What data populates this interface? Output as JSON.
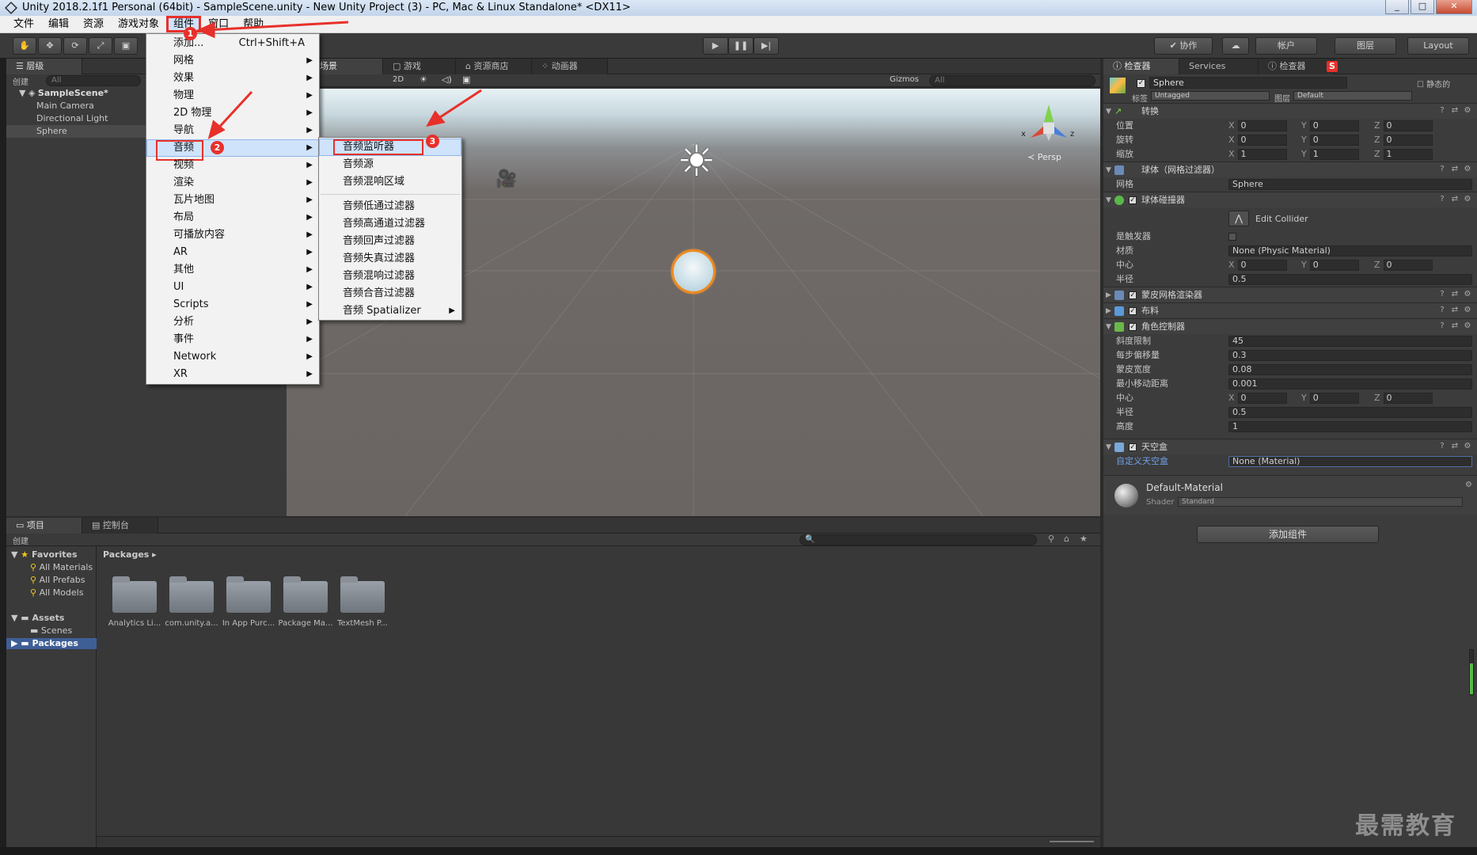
{
  "window": {
    "title": "Unity 2018.2.1f1 Personal (64bit) - SampleScene.unity - New Unity Project (3) - PC, Mac & Linux Standalone* <DX11>",
    "minimize": "_",
    "maximize": "□",
    "close": "✕"
  },
  "menubar": [
    "文件",
    "编辑",
    "资源",
    "游戏对象",
    "组件",
    "窗口",
    "帮助"
  ],
  "toolbar": {
    "collab": "✔ 协作",
    "account": "帐户",
    "layers": "图层",
    "layout": "Layout"
  },
  "hierarchy": {
    "tab": "层级",
    "create": "创建",
    "search_placeholder": "All",
    "scene": "SampleScene*",
    "items": [
      "Main Camera",
      "Directional Light",
      "Sphere"
    ]
  },
  "scene_view": {
    "tabs": [
      "场景",
      "游戏",
      "资源商店",
      "动画器"
    ],
    "mode_2d": "2D",
    "gizmos": "Gizmos",
    "search_placeholder": "All",
    "persp": "Persp",
    "axis_x": "x",
    "axis_z": "z"
  },
  "component_menu": {
    "items": [
      {
        "label": "添加...",
        "shortcut": "Ctrl+Shift+A",
        "sub": false
      },
      {
        "label": "网格",
        "sub": true
      },
      {
        "label": "效果",
        "sub": true
      },
      {
        "label": "物理",
        "sub": true
      },
      {
        "label": "2D 物理",
        "sub": true
      },
      {
        "label": "导航",
        "sub": true
      },
      {
        "label": "音频",
        "sub": true
      },
      {
        "label": "视频",
        "sub": true
      },
      {
        "label": "渲染",
        "sub": true
      },
      {
        "label": "瓦片地图",
        "sub": true
      },
      {
        "label": "布局",
        "sub": true
      },
      {
        "label": "可播放内容",
        "sub": true
      },
      {
        "label": "AR",
        "sub": true
      },
      {
        "label": "其他",
        "sub": true
      },
      {
        "label": "UI",
        "sub": true
      },
      {
        "label": "Scripts",
        "sub": true
      },
      {
        "label": "分析",
        "sub": true
      },
      {
        "label": "事件",
        "sub": true
      },
      {
        "label": "Network",
        "sub": true
      },
      {
        "label": "XR",
        "sub": true
      }
    ]
  },
  "audio_submenu": {
    "group1": [
      "音频监听器",
      "音频源",
      "音频混响区域"
    ],
    "group2": [
      "音频低通过滤器",
      "音频高通道过滤器",
      "音频回声过滤器",
      "音频失真过滤器",
      "音频混响过滤器",
      "音频合音过滤器",
      "音频 Spatializer"
    ]
  },
  "badges": [
    "1",
    "2",
    "3"
  ],
  "inspector": {
    "tabs": [
      "检查器",
      "Services",
      "检查器"
    ],
    "object_name": "Sphere",
    "static_label": "静态的",
    "tag_label": "标签",
    "tag_value": "Untagged",
    "layer_label": "图层",
    "layer_value": "Default",
    "transform": {
      "title": "转换",
      "rows": [
        {
          "label": "位置",
          "x": "0",
          "y": "0",
          "z": "0"
        },
        {
          "label": "旋转",
          "x": "0",
          "y": "0",
          "z": "0"
        },
        {
          "label": "缩放",
          "x": "1",
          "y": "1",
          "z": "1"
        }
      ]
    },
    "mesh_filter": {
      "title": "球体（网格过滤器）",
      "mesh_label": "网格",
      "mesh_value": "Sphere"
    },
    "sphere_collider": {
      "title": "球体碰撞器",
      "edit_button": "Edit Collider",
      "trigger_label": "是触发器",
      "material_label": "材质",
      "material_value": "None (Physic Material)",
      "center_label": "中心",
      "center": {
        "x": "0",
        "y": "0",
        "z": "0"
      },
      "radius_label": "半径",
      "radius_value": "0.5"
    },
    "skinned_mesh": {
      "title": "蒙皮网格渲染器"
    },
    "cloth": {
      "title": "布料"
    },
    "character_controller": {
      "title": "角色控制器",
      "rows": [
        {
          "label": "斜度限制",
          "value": "45"
        },
        {
          "label": "每步偏移量",
          "value": "0.3"
        },
        {
          "label": "蒙皮宽度",
          "value": "0.08"
        },
        {
          "label": "最小移动距离",
          "value": "0.001"
        }
      ],
      "center_label": "中心",
      "center": {
        "x": "0",
        "y": "0",
        "z": "0"
      },
      "radius_label": "半径",
      "radius_value": "0.5",
      "height_label": "高度",
      "height_value": "1"
    },
    "skybox": {
      "title": "天空盒",
      "custom_label": "自定义天空盒",
      "custom_value": "None (Material)"
    },
    "material": {
      "name": "Default-Material",
      "shader_label": "Shader",
      "shader_value": "Standard"
    },
    "add_component": "添加组件"
  },
  "project": {
    "tabs": [
      "项目",
      "控制台"
    ],
    "create": "创建",
    "favorites": "Favorites",
    "fav_items": [
      "All Materials",
      "All Prefabs",
      "All Models"
    ],
    "assets": "Assets",
    "scenes": "Scenes",
    "packages": "Packages",
    "breadcrumb": "Packages",
    "folders": [
      "Analytics Li...",
      "com.unity.a...",
      "In App Purc...",
      "Package Ma...",
      "TextMesh P..."
    ]
  },
  "watermark": "最需教育",
  "colors": {
    "accent": "#e8302a",
    "highlight": "#cfe3fb",
    "editor_bg": "#3c3c3c",
    "selection": "#3e5f96"
  }
}
